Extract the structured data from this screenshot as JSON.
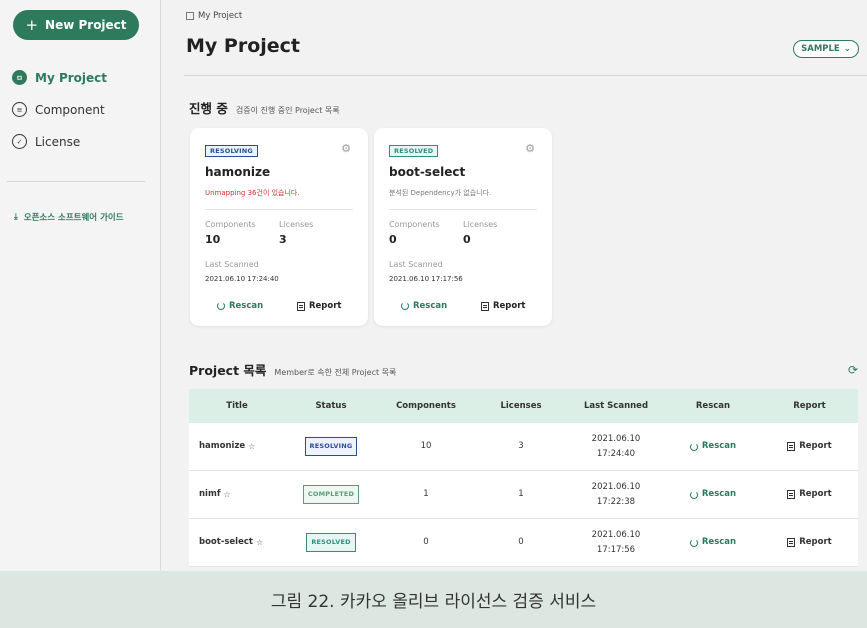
{
  "sidebar": {
    "new_project_label": "New Project",
    "nav": [
      {
        "label": "My Project",
        "icon": "project-icon",
        "active": true
      },
      {
        "label": "Component",
        "icon": "list-icon",
        "active": false
      },
      {
        "label": "License",
        "icon": "check-circle-icon",
        "active": false
      }
    ],
    "guide_link": "오픈소스 소프트웨어 가이드",
    "guide_icon": "download-icon"
  },
  "header": {
    "breadcrumb": "My Project",
    "title": "My Project",
    "sample_label": "SAMPLE"
  },
  "in_progress": {
    "title": "진행 중",
    "subtitle": "검증이 진행 중인 Project 목록",
    "cards": [
      {
        "status": "RESOLVING",
        "name": "hamonize",
        "message": "Unmapping 36건이 있습니다.",
        "components_label": "Components",
        "components": "10",
        "licenses_label": "Licenses",
        "licenses": "3",
        "last_scanned_label": "Last Scanned",
        "last_scanned": "2021.06.10 17:24:40",
        "rescan": "Rescan",
        "report": "Report"
      },
      {
        "status": "RESOLVED",
        "name": "boot-select",
        "message": "분석된 Dependency가 없습니다.",
        "components_label": "Components",
        "components": "0",
        "licenses_label": "Licenses",
        "licenses": "0",
        "last_scanned_label": "Last Scanned",
        "last_scanned": "2021.06.10 17:17:56",
        "rescan": "Rescan",
        "report": "Report"
      }
    ]
  },
  "project_list": {
    "title": "Project 목록",
    "subtitle": "Member로 속한 전체 Project 목록",
    "columns": [
      "Title",
      "Status",
      "Components",
      "Licenses",
      "Last Scanned",
      "Rescan",
      "Report"
    ],
    "rows": [
      {
        "title": "hamonize",
        "status": "RESOLVING",
        "components": "10",
        "licenses": "3",
        "date": "2021.06.10",
        "time": "17:24:40",
        "rescan": "Rescan",
        "report": "Report"
      },
      {
        "title": "nimf",
        "status": "COMPLETED",
        "components": "1",
        "licenses": "1",
        "date": "2021.06.10",
        "time": "17:22:38",
        "rescan": "Rescan",
        "report": "Report"
      },
      {
        "title": "boot-select",
        "status": "RESOLVED",
        "components": "0",
        "licenses": "0",
        "date": "2021.06.10",
        "time": "17:17:56",
        "rescan": "Rescan",
        "report": "Report"
      }
    ]
  },
  "caption": "그림 22. 카카오 올리브 라이선스 검증 서비스",
  "colors": {
    "accent": "#2e7a5c",
    "resolving": "#2b4b9b",
    "resolved": "#2e8f80",
    "warning": "#d2312e"
  }
}
